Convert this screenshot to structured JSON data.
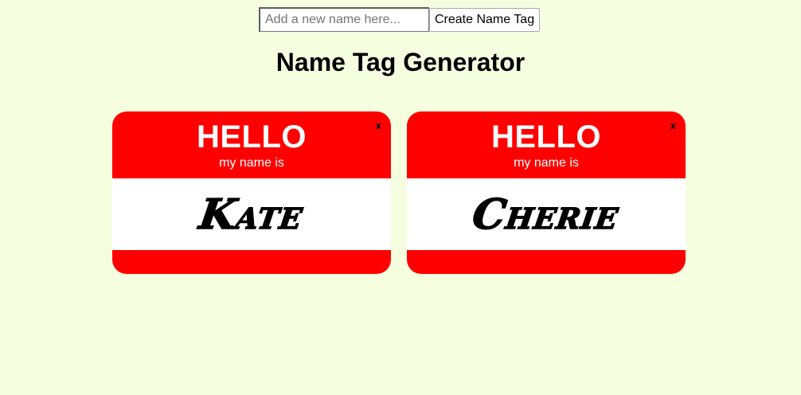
{
  "form": {
    "input_placeholder": "Add a new name here...",
    "input_value": "",
    "create_button_label": "Create Name Tag"
  },
  "page": {
    "title": "Name Tag Generator"
  },
  "tags": [
    {
      "hello": "HELLO",
      "subtitle": "my name is",
      "name": "Kate",
      "close": "x"
    },
    {
      "hello": "HELLO",
      "subtitle": "my name is",
      "name": "Cherie",
      "close": "x"
    }
  ],
  "colors": {
    "background": "#f5ffe0",
    "tag_red": "#ff0000",
    "tag_white": "#ffffff"
  }
}
